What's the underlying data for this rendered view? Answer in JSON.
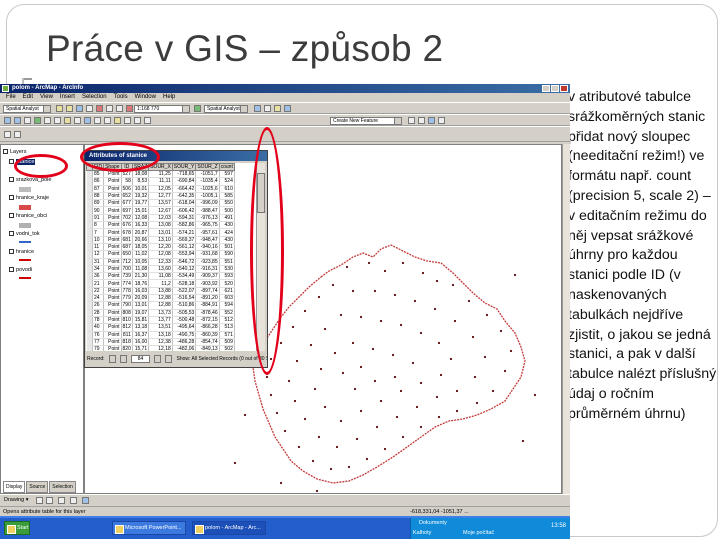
{
  "slide": {
    "title": "Práce v GIS – způsob 2",
    "text": "v atributové tabulce srážkoměrných stanic přidat nový sloupec (needitační režim!) ve formátu např. count (precision 5, scale 2) – v editačním režimu do něj vepsat srážkové úhrny pro každou stanici podle ID (v naskenovaných tabulkách nejdříve zjistit, o jakou se jedná stanici, a pak v další tabulce nalézt příslušný údaj o ročním průměrném úhrnu)"
  },
  "arcmap": {
    "window_title": "polom - ArcMap - ArcInfo",
    "menu": [
      "File",
      "Edit",
      "View",
      "Insert",
      "Selection",
      "Tools",
      "Window",
      "Help"
    ],
    "toolbar": {
      "editor_label": "Spatial Analyst",
      "scale_value": "1:168 770",
      "layer_combo": "Spatial Analyst ▾",
      "target_combo": "Create New Feature"
    },
    "toc": {
      "tabs": [
        "Display",
        "Source",
        "Selection"
      ],
      "layers_header": "Layers",
      "layers": [
        {
          "name": "stanice",
          "checked": true,
          "color": "#cc0000"
        },
        {
          "name": "srazkova_pole",
          "checked": false,
          "color": "#bbbbbb"
        },
        {
          "name": "hranice_kraje",
          "checked": false,
          "color": "#d84a4a"
        },
        {
          "name": "hranice_obci",
          "checked": false,
          "color": "#b0b0b0"
        },
        {
          "name": "vodni_tok",
          "checked": false,
          "color": "#3366cc"
        },
        {
          "name": "hranice",
          "checked": false,
          "color": "#cc0000"
        },
        {
          "name": "povodi",
          "checked": true,
          "color": "#cc0000"
        }
      ]
    },
    "attributes_window": {
      "title": "Attributes of stanice",
      "columns": [
        "FID",
        "Shape",
        "ID",
        "SRAZ",
        "SOUR_X",
        "SOUR_Y",
        "SOUR_Z",
        "count"
      ],
      "rows": [
        [
          "85",
          "Point",
          "527",
          "18,08",
          "11,25",
          "-718,65",
          "-1051,7",
          "597"
        ],
        [
          "86",
          "Point",
          "58",
          "8,53",
          "11,11",
          "-690,84",
          "-1035,4",
          "524"
        ],
        [
          "87",
          "Point",
          "506",
          "10,01",
          "12,05",
          "-664,42",
          "-1025,6",
          "610"
        ],
        [
          "88",
          "Point",
          "652",
          "19,32",
          "12,77",
          "-642,35",
          "-1005,1",
          "585"
        ],
        [
          "89",
          "Point",
          "677",
          "19,77",
          "13,57",
          "-618,04",
          "-996,09",
          "550"
        ],
        [
          "90",
          "Point",
          "697",
          "15,01",
          "12,67",
          "-606,42",
          "-988,47",
          "500"
        ],
        [
          "91",
          "Point",
          "702",
          "12,08",
          "12,03",
          "-594,31",
          "-976,13",
          "491"
        ],
        [
          "8",
          "Point",
          "676",
          "16,33",
          "13,08",
          "-582,86",
          "-965,75",
          "430"
        ],
        [
          "7",
          "Point",
          "678",
          "20,87",
          "13,01",
          "-574,21",
          "-957,61",
          "424"
        ],
        [
          "10",
          "Point",
          "681",
          "20,66",
          "13,10",
          "-569,37",
          "-948,47",
          "430"
        ],
        [
          "11",
          "Point",
          "687",
          "18,05",
          "12,20",
          "-561,12",
          "-940,16",
          "501"
        ],
        [
          "12",
          "Point",
          "650",
          "11,02",
          "12,08",
          "-553,94",
          "-931,68",
          "590"
        ],
        [
          "31",
          "Point",
          "712",
          "10,05",
          "12,33",
          "-546,72",
          "-923,85",
          "551"
        ],
        [
          "34",
          "Point",
          "700",
          "11,08",
          "13,60",
          "-540,12",
          "-916,31",
          "530"
        ],
        [
          "36",
          "Point",
          "739",
          "21,30",
          "11,08",
          "-534,49",
          "-909,37",
          "593"
        ],
        [
          "21",
          "Point",
          "774",
          "18,76",
          "11,2",
          "-528,18",
          "-903,92",
          "520"
        ],
        [
          "22",
          "Point",
          "778",
          "16,03",
          "13,88",
          "-522,07",
          "-897,74",
          "621"
        ],
        [
          "24",
          "Point",
          "779",
          "20,09",
          "12,88",
          "-516,54",
          "-891,20",
          "603"
        ],
        [
          "26",
          "Point",
          "790",
          "13,01",
          "12,88",
          "-510,86",
          "-884,91",
          "594"
        ],
        [
          "28",
          "Point",
          "808",
          "19,07",
          "13,73",
          "-505,53",
          "-878,46",
          "552"
        ],
        [
          "78",
          "Point",
          "810",
          "15,81",
          "13,77",
          "-500,48",
          "-872,15",
          "512"
        ],
        [
          "40",
          "Point",
          "812",
          "13,18",
          "13,51",
          "-495,64",
          "-866,28",
          "513"
        ],
        [
          "76",
          "Point",
          "811",
          "16,37",
          "13,18",
          "-490,75",
          "-860,39",
          "571"
        ],
        [
          "77",
          "Point",
          "818",
          "16,00",
          "12,38",
          "-486,28",
          "-854,74",
          "509"
        ],
        [
          "79",
          "Point",
          "820",
          "15,71",
          "12,18",
          "-482,06",
          "-849,13",
          "502"
        ],
        [
          "80",
          "Point",
          "828",
          "19,50",
          "14,40",
          "-478,39",
          "-843,87",
          "580"
        ],
        [
          "81",
          "Point",
          "826",
          "20,80",
          "15,10",
          "-474,12",
          "-838,42",
          "593"
        ],
        [
          "85",
          "Point",
          "835",
          "11,33",
          "13,76",
          "-470,26",
          "-833,16",
          "561"
        ]
      ],
      "record_label": "Record:",
      "record_value": "84",
      "show_label": "Show: All  Selected  Records (0 out of 80 Selected)"
    },
    "drawing_label": "Drawing ▾",
    "status": "Opens attribute table for this layer",
    "status_coords": "-618,331,04  -1051,37 ...",
    "taskbar": {
      "items": [
        "Start",
        "Microsoft PowerPoint...",
        "polom - ArcMap - Arc..."
      ],
      "tray": [
        "Dokumenty",
        "Kalhoty",
        "Moje počítač"
      ],
      "clock": "13:58"
    }
  },
  "colors": {
    "highlight": "#e3001b",
    "boundary": "#c43a3a",
    "station": "#5a0a0a"
  }
}
